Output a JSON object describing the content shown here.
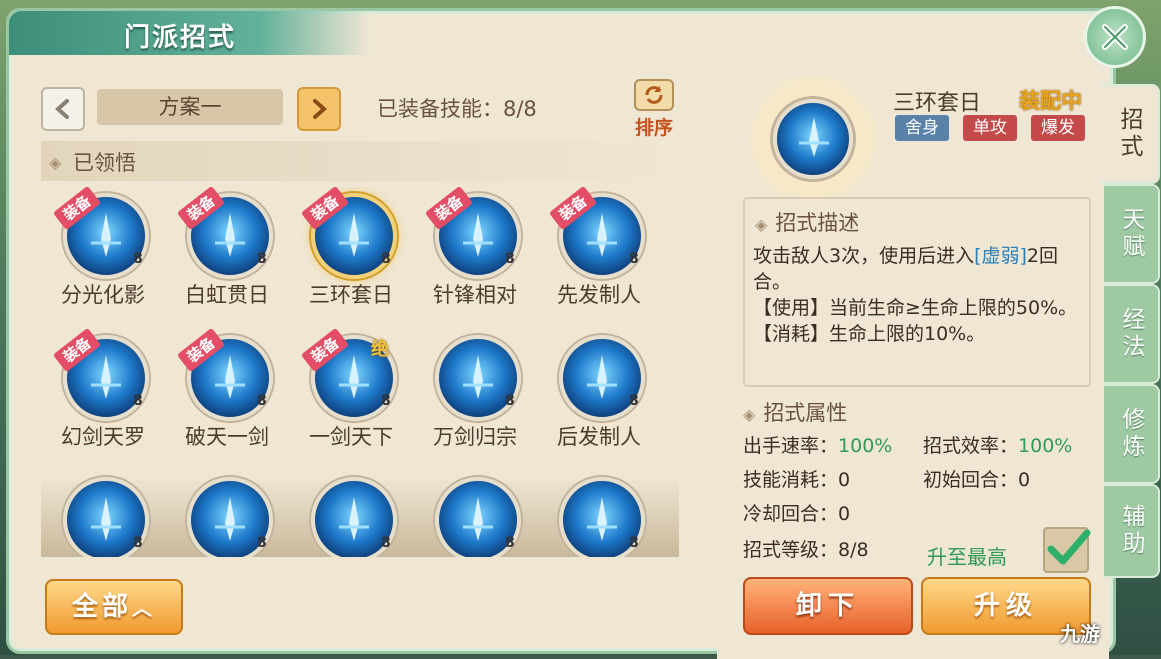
{
  "header": {
    "title": "门派招式"
  },
  "plan": {
    "name": "方案一",
    "equipped_count": "已装备技能：8/8",
    "sort_label": "排序"
  },
  "section": {
    "learned_label": "已领悟"
  },
  "skills": [
    {
      "name": "分光化影",
      "level": "8",
      "badge": "装备"
    },
    {
      "name": "白虹贯日",
      "level": "8",
      "badge": "装备"
    },
    {
      "name": "三环套日",
      "level": "8",
      "badge": "装备"
    },
    {
      "name": "针锋相对",
      "level": "8",
      "badge": "装备"
    },
    {
      "name": "先发制人",
      "level": "8",
      "badge": "装备"
    },
    {
      "name": "幻剑天罗",
      "level": "8",
      "badge": "装备"
    },
    {
      "name": "破天一剑",
      "level": "8",
      "badge": "装备"
    },
    {
      "name": "一剑天下",
      "level": "8",
      "badge": "装备",
      "ult": "绝"
    },
    {
      "name": "万剑归宗",
      "level": "8"
    },
    {
      "name": "后发制人",
      "level": "8"
    },
    {
      "name": "",
      "level": "8"
    },
    {
      "name": "",
      "level": "8"
    },
    {
      "name": "",
      "level": "8"
    },
    {
      "name": "",
      "level": "8"
    },
    {
      "name": "",
      "level": "8"
    }
  ],
  "filter": {
    "all_label": "全部"
  },
  "detail": {
    "title": "三环套日",
    "status": "装配中",
    "tags": [
      "舍身",
      "单攻",
      "爆发"
    ],
    "desc_head": "招式描述",
    "desc_line1_a": "攻击敌人3次，使用后进入",
    "desc_line1_kw": "[虚弱]",
    "desc_line1_b": "2回合。",
    "desc_line2": "【使用】当前生命≥生命上限的50%。",
    "desc_line3": "【消耗】生命上限的10%。",
    "attr_head": "招式属性",
    "attrs": {
      "speed_label": "出手速率：",
      "speed_val": "100%",
      "eff_label": "招式效率：",
      "eff_val": "100%",
      "cost_label": "技能消耗：",
      "cost_val": "0",
      "start_label": "初始回合：",
      "start_val": "0",
      "cd_label": "冷却回合：",
      "cd_val": "0",
      "lvl_label": "招式等级：",
      "lvl_val": "8/8"
    },
    "maxup_label": "升至最高",
    "unequip_label": "卸下",
    "upgrade_label": "升级"
  },
  "tabs": [
    "招式",
    "天赋",
    "经法",
    "修炼",
    "辅助"
  ],
  "watermark": "九游",
  "colors": {
    "accent_green": "#2f9a56",
    "accent_orange": "#f19a2f",
    "badge_red": "#e34d66",
    "keyword_blue": "#2d7fb8"
  }
}
